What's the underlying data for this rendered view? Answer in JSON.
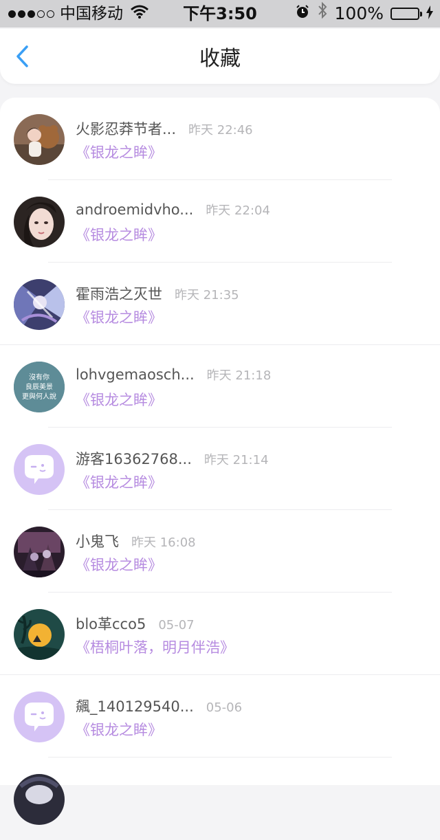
{
  "status_bar": {
    "carrier": "中国移动",
    "time": "下午3:50",
    "battery": "100%"
  },
  "nav": {
    "title": "收藏"
  },
  "colors": {
    "accent_purple": "#b68be0",
    "back_blue": "#3a9ff5"
  },
  "favorites": [
    {
      "user": "火影忍莽节者...",
      "time": "昨天 22:46",
      "work": "《银龙之眸》"
    },
    {
      "user": "androemidvho...",
      "time": "昨天 22:04",
      "work": "《银龙之眸》"
    },
    {
      "user": "霍雨浩之灭世",
      "time": "昨天 21:35",
      "work": "《银龙之眸》"
    },
    {
      "user": "lohvgemaosch...",
      "time": "昨天 21:18",
      "work": "《银龙之眸》",
      "avatar_text": [
        "沒有你",
        "良辰美景",
        "更與何人說"
      ]
    },
    {
      "user": "游客16362768...",
      "time": "昨天 21:14",
      "work": "《银龙之眸》"
    },
    {
      "user": "小鬼飞",
      "time": "昨天 16:08",
      "work": "《银龙之眸》"
    },
    {
      "user": "blo革cco5",
      "time": "05-07",
      "work": "《梧桐叶落，明月伴浩》"
    },
    {
      "user": "飆_140129540...",
      "time": "05-06",
      "work": "《银龙之眸》"
    }
  ]
}
